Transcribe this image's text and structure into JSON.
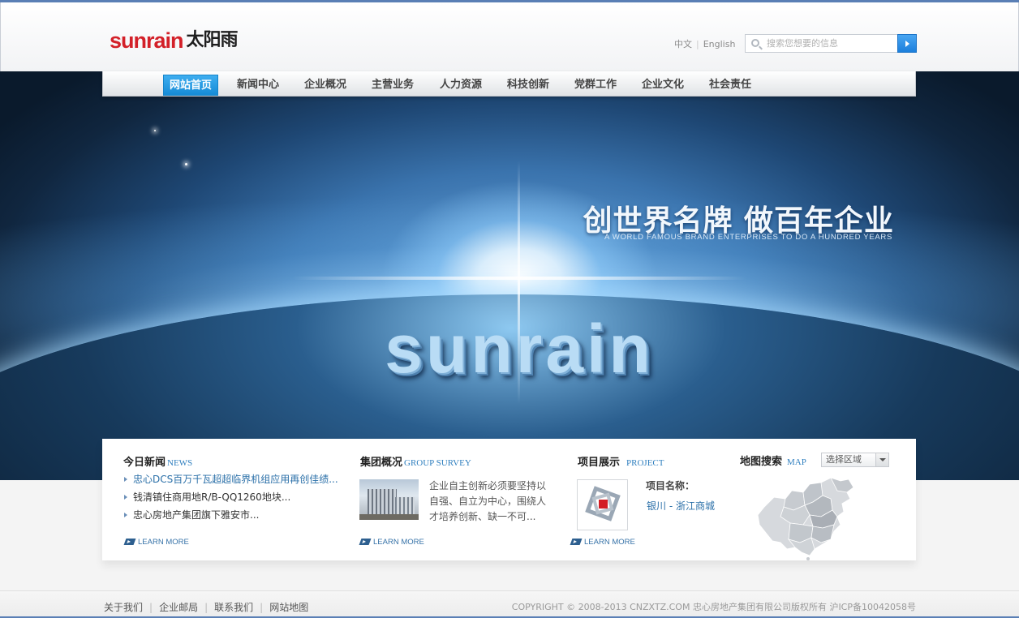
{
  "header": {
    "logo_en": "sunrain",
    "logo_cn": "太阳雨",
    "lang_cn": "中文",
    "lang_en": "English",
    "search_placeholder": "搜索您想要的信息"
  },
  "nav": {
    "items": [
      "网站首页",
      "新闻中心",
      "企业概况",
      "主营业务",
      "人力资源",
      "科技创新",
      "党群工作",
      "企业文化",
      "社会责任"
    ],
    "active_index": 0
  },
  "banner": {
    "slogan": "创世界名牌  做百年企业",
    "slogan_en": "A WORLD FAMOUS BRAND ENTERPRISES TO DO A HUNDRED YEARS",
    "big_logo": "sunrain"
  },
  "news": {
    "title": "今日新闻",
    "title_en": "NEWS",
    "items": [
      "忠心DCS百万千瓦超超临界机组应用再创佳绩...",
      "钱清镇住商用地R/B-QQ1260地块...",
      "忠心房地产集团旗下雅安市..."
    ],
    "more": "LEARN MORE"
  },
  "survey": {
    "title": "集团概况",
    "title_en": "GROUP SURVEY",
    "text": "企业自主创新必须要坚持以自强、自立为中心，围绕人才培养创新、缺一不可...",
    "more": "LEARN MORE"
  },
  "project": {
    "title": "项目展示",
    "title_en": "PROJECT",
    "label": "项目名称：",
    "name": "银川 - 浙江商城",
    "more": "LEARN MORE"
  },
  "map": {
    "title": "地图搜索",
    "title_en": "MAP",
    "select_value": "选择区域"
  },
  "footer": {
    "links": [
      "关于我们",
      "企业邮局",
      "联系我们",
      "网站地图"
    ],
    "copyright": "COPYRIGHT © 2008-2013 CNZXTZ.COM 忠心房地产集团有限公司版权所有 沪ICP备10042058号"
  },
  "colors": {
    "brand_red": "#d32028",
    "nav_active": "#168bd6",
    "link_blue": "#2a6fa8"
  }
}
